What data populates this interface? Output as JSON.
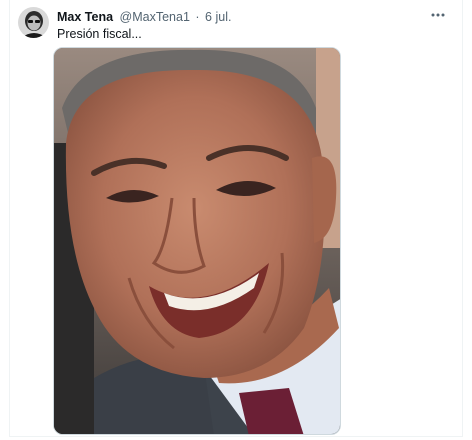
{
  "tweet": {
    "author_name": "Max Tena",
    "author_handle": "@MaxTena1",
    "separator": "·",
    "date": "6 jul.",
    "text": "Presión fiscal..."
  },
  "icons": {
    "more": "more-horizontal-icon",
    "avatar": "user-avatar"
  },
  "colors": {
    "text_primary": "#0f1419",
    "text_secondary": "#536471",
    "border": "#cfd9de"
  }
}
